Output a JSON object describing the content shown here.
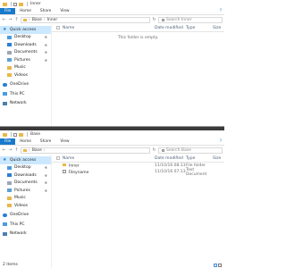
{
  "colors": {
    "accent": "#1979ca",
    "folder": "#e8b84a",
    "selected": "#cce8ff"
  },
  "window1": {
    "title": "Inner",
    "tabs": [
      "File",
      "Home",
      "Share",
      "View"
    ],
    "breadcrumb": [
      "Base",
      "Inner"
    ],
    "search_placeholder": "Search Inner",
    "nav": [
      {
        "label": "Quick access",
        "icon": "star-icon",
        "pinned": false
      },
      {
        "label": "Desktop",
        "icon": "desktop-icon",
        "pinned": true
      },
      {
        "label": "Downloads",
        "icon": "downloads-icon",
        "pinned": true
      },
      {
        "label": "Documents",
        "icon": "documents-icon",
        "pinned": true
      },
      {
        "label": "Pictures",
        "icon": "pictures-icon",
        "pinned": true
      },
      {
        "label": "Music",
        "icon": "music-icon",
        "pinned": false
      },
      {
        "label": "Videos",
        "icon": "videos-icon",
        "pinned": false
      },
      {
        "label": "OneDrive",
        "icon": "onedrive-icon",
        "pinned": false
      },
      {
        "label": "This PC",
        "icon": "pc-icon",
        "pinned": false
      },
      {
        "label": "Network",
        "icon": "network-icon",
        "pinned": false
      }
    ],
    "columns": [
      "Name",
      "Date modified",
      "Type",
      "Size"
    ],
    "empty_message": "This folder is empty."
  },
  "window2": {
    "title": "Base",
    "tabs": [
      "File",
      "Home",
      "Share",
      "View"
    ],
    "breadcrumb": [
      "Base"
    ],
    "search_placeholder": "Search Base",
    "nav": [
      {
        "label": "Quick access",
        "icon": "star-icon",
        "pinned": false
      },
      {
        "label": "Desktop",
        "icon": "desktop-icon",
        "pinned": true
      },
      {
        "label": "Downloads",
        "icon": "downloads-icon",
        "pinned": true
      },
      {
        "label": "Documents",
        "icon": "documents-icon",
        "pinned": true
      },
      {
        "label": "Pictures",
        "icon": "pictures-icon",
        "pinned": true
      },
      {
        "label": "Music",
        "icon": "music-icon",
        "pinned": false
      },
      {
        "label": "Videos",
        "icon": "videos-icon",
        "pinned": false
      },
      {
        "label": "OneDrive",
        "icon": "onedrive-icon",
        "pinned": false
      },
      {
        "label": "This PC",
        "icon": "pc-icon",
        "pinned": false
      },
      {
        "label": "Network",
        "icon": "network-icon",
        "pinned": false
      }
    ],
    "columns": [
      "Name",
      "Date modified",
      "Type",
      "Size"
    ],
    "rows": [
      {
        "name": "Inner",
        "date": "11/10/16 08:13",
        "type": "File folder",
        "size": "",
        "icon": "folder-icon"
      },
      {
        "name": "Fileyname",
        "date": "11/10/16 07:13",
        "type": "Text Document",
        "size": "",
        "icon": "text-file-icon"
      }
    ],
    "status": "2 items"
  }
}
